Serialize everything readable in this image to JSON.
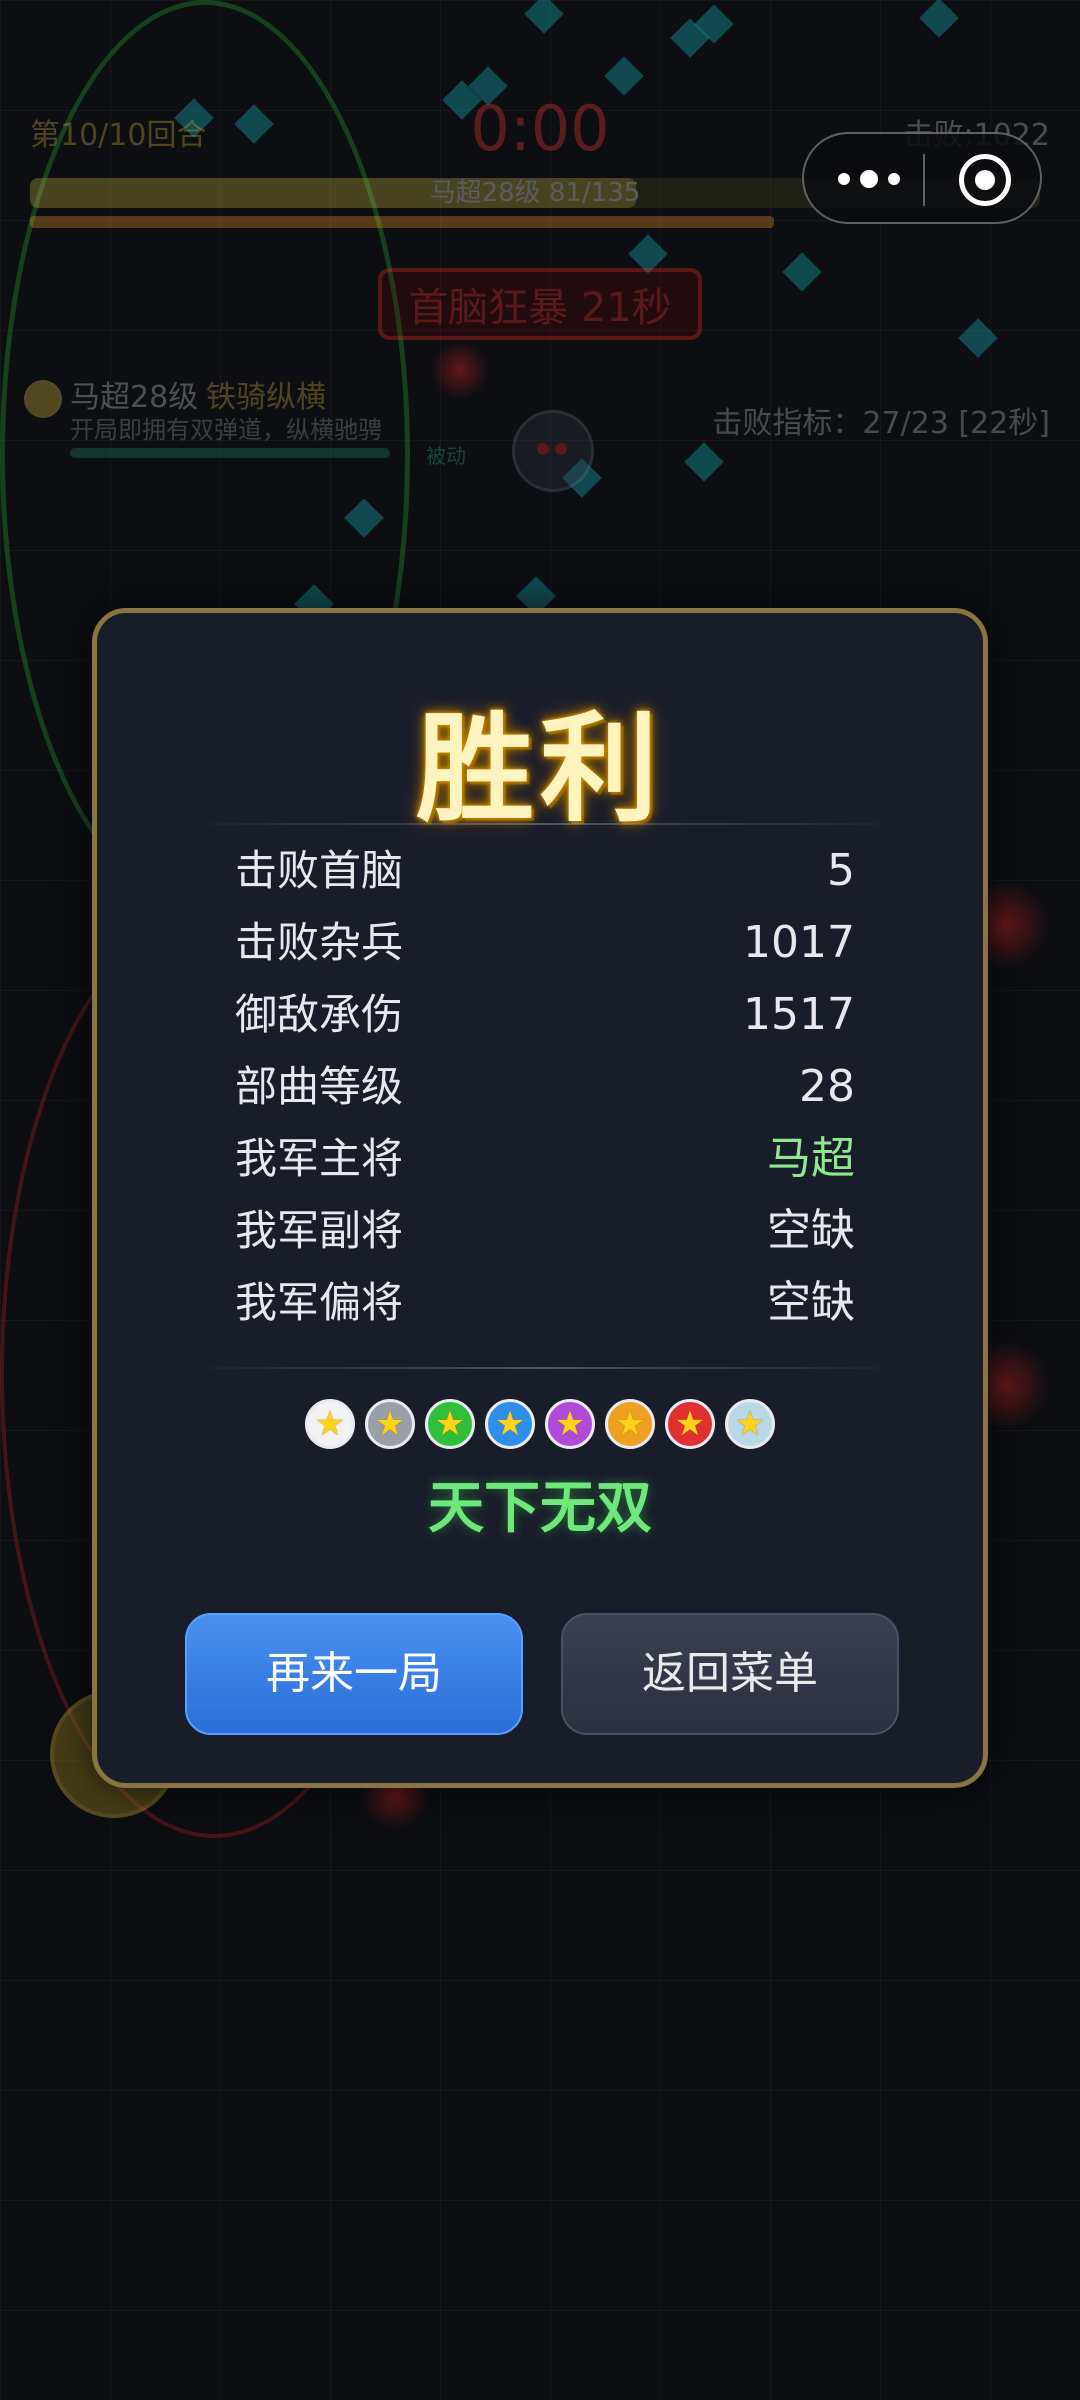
{
  "hud": {
    "round": "第10/10回合",
    "timer": "0:00",
    "kills": "击败:1022",
    "xp_text": "马超28级  81/135",
    "xp_progress": 0.6,
    "boss_rage": "首脑狂暴 21秒",
    "hero_name": "马超28级",
    "hero_skill": "铁骑纵横",
    "hero_desc": "开局即拥有双弹道，纵横驰骋",
    "passive": "被动",
    "target": "击败指标：27/23 [22秒]"
  },
  "capsule": {
    "more_icon": "more-icon",
    "close_icon": "target-close-icon"
  },
  "victory": {
    "title": "胜利",
    "stats": [
      {
        "label": "击败首脑",
        "value": "5"
      },
      {
        "label": "击败杂兵",
        "value": "1017"
      },
      {
        "label": "御敌承伤",
        "value": "1517"
      },
      {
        "label": "部曲等级",
        "value": "28"
      },
      {
        "label": "我军主将",
        "value": "马超"
      },
      {
        "label": "我军副将",
        "value": "空缺"
      },
      {
        "label": "我军偏将",
        "value": "空缺"
      }
    ],
    "star_badges": [
      {
        "color": "#f2f2f2"
      },
      {
        "color": "#9a9ea8"
      },
      {
        "color": "#2fbf3a"
      },
      {
        "color": "#2f8ee8"
      },
      {
        "color": "#b04ad8"
      },
      {
        "color": "#f0a020"
      },
      {
        "color": "#e03030"
      },
      {
        "color": "#b8d8e8"
      }
    ],
    "rank_title": "天下无双",
    "buttons": {
      "again": "再来一局",
      "menu": "返回菜单"
    },
    "colors": {
      "accent_green": "#8ee88e",
      "again_button": "#3a80e8",
      "border_gold": "#8a7440"
    }
  }
}
